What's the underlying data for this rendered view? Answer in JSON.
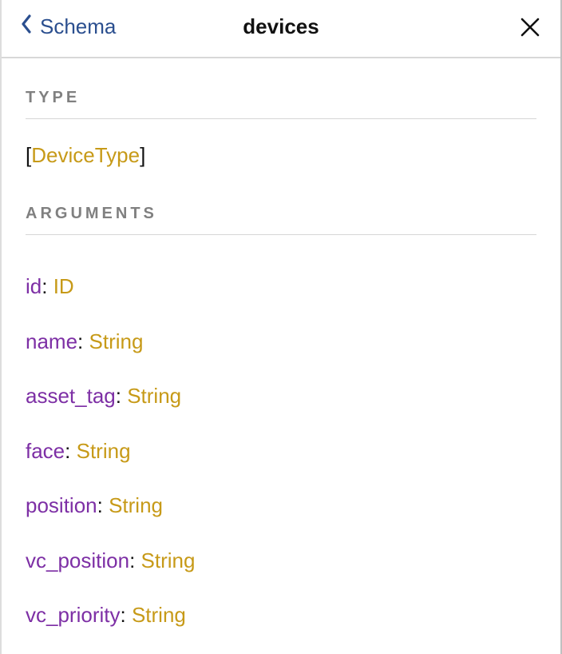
{
  "header": {
    "back_label": "Schema",
    "title": "devices"
  },
  "sections": {
    "type_label": "TYPE",
    "arguments_label": "ARGUMENTS"
  },
  "type_value": {
    "open": "[",
    "name": "DeviceType",
    "close": "]"
  },
  "arguments": [
    {
      "name": "id",
      "type": "ID"
    },
    {
      "name": "name",
      "type": "String"
    },
    {
      "name": "asset_tag",
      "type": "String"
    },
    {
      "name": "face",
      "type": "String"
    },
    {
      "name": "position",
      "type": "String"
    },
    {
      "name": "vc_position",
      "type": "String"
    },
    {
      "name": "vc_priority",
      "type": "String"
    }
  ]
}
